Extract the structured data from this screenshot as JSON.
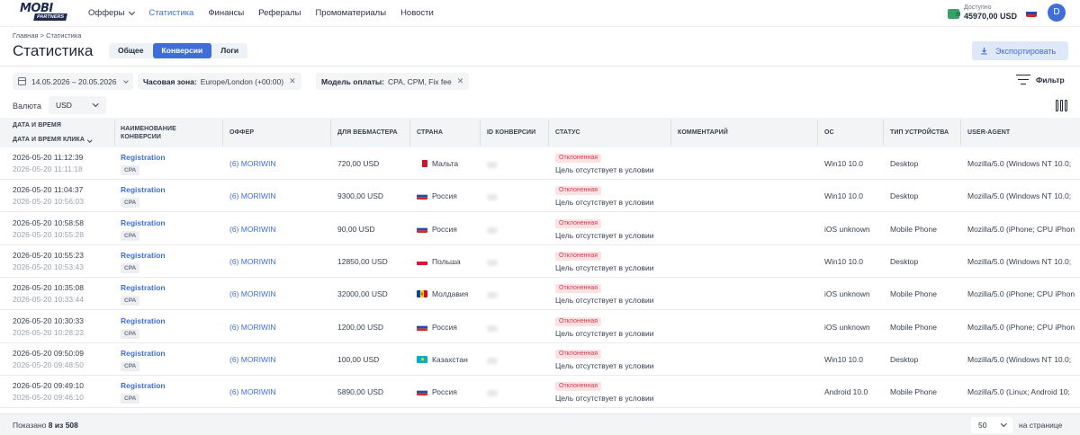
{
  "header": {
    "logo_top": "MOBI",
    "logo_bottom": "PARTNERS",
    "nav": [
      {
        "label": "Офферы",
        "dropdown": true
      },
      {
        "label": "Статистика",
        "active": true
      },
      {
        "label": "Финансы"
      },
      {
        "label": "Рефералы"
      },
      {
        "label": "Промоматериалы"
      },
      {
        "label": "Новости"
      }
    ],
    "balance_label": "Доступно",
    "balance_value": "45970,00 USD",
    "avatar_letter": "D"
  },
  "breadcrumb": "Главная > Статистика",
  "page_title": "Статистика",
  "view_tabs": [
    "Общее",
    "Конверсии",
    "Логи"
  ],
  "active_view_tab": "Конверсии",
  "export_label": "Экспортировать",
  "filters": {
    "date_range": "14.05.2026 – 20.05.2026",
    "timezone_label": "Часовая зона:",
    "timezone_value": "Europe/London (+00:00)",
    "payment_label": "Модель оплаты:",
    "payment_value": "CPA, CPM, Fix fee",
    "filter_button": "Фильтр"
  },
  "currency": {
    "label": "Валюта",
    "value": "USD"
  },
  "table": {
    "headers": {
      "datetime": "Дата и время",
      "click_datetime": "Дата и время клика",
      "conversion_name": "Наименование конверсии",
      "offer": "Оффер",
      "webmaster": "Для вебмастера",
      "country": "Страна",
      "conversion_id": "ID конверсии",
      "status": "Статус",
      "comment": "Комментарий",
      "os": "ОС",
      "device_type": "Тип устройства",
      "user_agent": "User-Agent"
    },
    "rows": [
      {
        "dt": "2026-05-20 11:12:39",
        "click": "2026-05-20 11:11:18",
        "conv": "Registration",
        "type": "CPA",
        "offer": "(6) MORIWIN",
        "amount": "720,00 USD",
        "country": "Мальта",
        "flag": "mt",
        "status": "Отклоненная",
        "reason": "Цель отсутствует в условии",
        "os": "Win10 10.0",
        "device": "Desktop",
        "ua": "Mozilla/5.0 (Windows NT 10.0;"
      },
      {
        "dt": "2026-05-20 11:04:37",
        "click": "2026-05-20 10:56:03",
        "conv": "Registration",
        "type": "CPA",
        "offer": "(6) MORIWIN",
        "amount": "9300,00 USD",
        "country": "Россия",
        "flag": "ru",
        "status": "Отклоненная",
        "reason": "Цель отсутствует в условии",
        "os": "Win10 10.0",
        "device": "Desktop",
        "ua": "Mozilla/5.0 (Windows NT 10.0;"
      },
      {
        "dt": "2026-05-20 10:58:58",
        "click": "2026-05-20 10:55:28",
        "conv": "Registration",
        "type": "CPA",
        "offer": "(6) MORIWIN",
        "amount": "90,00 USD",
        "country": "Россия",
        "flag": "ru",
        "status": "Отклоненная",
        "reason": "Цель отсутствует в условии",
        "os": "iOS unknown",
        "device": "Mobile Phone",
        "ua": "Mozilla/5.0 (iPhone; CPU iPhon"
      },
      {
        "dt": "2026-05-20 10:55:23",
        "click": "2026-05-20 10:53:43",
        "conv": "Registration",
        "type": "CPA",
        "offer": "(6) MORIWIN",
        "amount": "12850,00 USD",
        "country": "Польша",
        "flag": "pl",
        "status": "Отклоненная",
        "reason": "Цель отсутствует в условии",
        "os": "Win10 10.0",
        "device": "Desktop",
        "ua": "Mozilla/5.0 (Windows NT 10.0;"
      },
      {
        "dt": "2026-05-20 10:35:08",
        "click": "2026-05-20 10:33:44",
        "conv": "Registration",
        "type": "CPA",
        "offer": "(6) MORIWIN",
        "amount": "32000,00 USD",
        "country": "Молдавия",
        "flag": "md",
        "status": "Отклоненная",
        "reason": "Цель отсутствует в условии",
        "os": "iOS unknown",
        "device": "Mobile Phone",
        "ua": "Mozilla/5.0 (iPhone; CPU iPhon"
      },
      {
        "dt": "2026-05-20 10:30:33",
        "click": "2026-05-20 10:28:23",
        "conv": "Registration",
        "type": "CPA",
        "offer": "(6) MORIWIN",
        "amount": "1200,00 USD",
        "country": "Россия",
        "flag": "ru",
        "status": "Отклоненная",
        "reason": "Цель отсутствует в условии",
        "os": "iOS unknown",
        "device": "Mobile Phone",
        "ua": "Mozilla/5.0 (iPhone; CPU iPhon"
      },
      {
        "dt": "2026-05-20 09:50:09",
        "click": "2026-05-20 09:48:50",
        "conv": "Registration",
        "type": "CPA",
        "offer": "(6) MORIWIN",
        "amount": "100,00 USD",
        "country": "Казахстан",
        "flag": "kz",
        "status": "Отклоненная",
        "reason": "Цель отсутствует в условии",
        "os": "Win10 10.0",
        "device": "Desktop",
        "ua": "Mozilla/5.0 (Windows NT 10.0;"
      },
      {
        "dt": "2026-05-20 09:49:10",
        "click": "2026-05-20 09:46:10",
        "conv": "Registration",
        "type": "CPA",
        "offer": "(6) MORIWIN",
        "amount": "5890,00 USD",
        "country": "Россия",
        "flag": "ru",
        "status": "Отклоненная",
        "reason": "Цель отсутствует в условии",
        "os": "Android 10.0",
        "device": "Mobile Phone",
        "ua": "Mozilla/5.0 (Linux; Android 10;"
      }
    ]
  },
  "footer": {
    "shown_label": "Показано",
    "shown_value": "8 из 508",
    "per_page": "50",
    "per_page_label": "на странице"
  },
  "colors": {
    "accent": "#3f6ed8",
    "status_rejected_bg": "#fde2e4",
    "status_rejected_text": "#d33c4c"
  }
}
